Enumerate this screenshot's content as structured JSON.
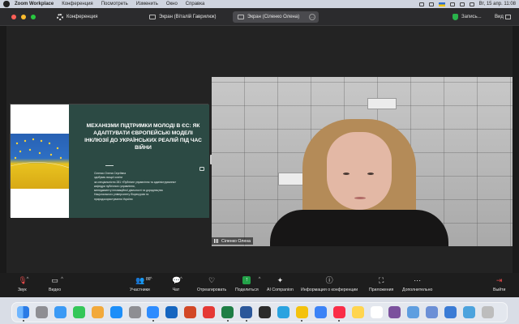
{
  "menubar": {
    "app": "Zoom Workplace",
    "items": [
      "Конференция",
      "Посмотреть",
      "Изменить",
      "Окно",
      "Справка"
    ],
    "clock": "Вт, 15 апр. 11:08"
  },
  "titlebar": {
    "conference_label": "Конференция",
    "tab1": "Экран (Віталій Гаврилюк)",
    "tab2": "Экран (Сіленко Олена)",
    "record_label": "Запись...",
    "view_label": "Вид"
  },
  "slide": {
    "title": "МЕХАНІЗМИ ПІДТРИМКИ МОЛОДІ В ЄС: ЯК АДАПТУВАТИ ЄВРОПЕЙСЬКІ МОДЕЛІ ІНКЛЮЗІЇ ДО УКРАЇНСЬКИХ РЕАЛІЙ ПІД ЧАС ВІЙНИ",
    "body": [
      "Сіленко Олена Сергіївна",
      "здобувач вищої освіти",
      "за спеціальністю 281 «Публічне управління та адміністрування»",
      "кафедри публічного управління,",
      "менеджменту інноваційної діяльності та дорадництва",
      "Національного університету біоресурсів та",
      "природокористування України"
    ]
  },
  "video": {
    "participant_name": "Сіленко Олена"
  },
  "toolbar": {
    "mute_label": "Звук",
    "video_label": "Видео",
    "participants_label": "Участники",
    "participants_count": "86",
    "chat_label": "Чат",
    "react_label": "Отреагировать",
    "share_label": "Поделиться",
    "ai_label": "AI Companion",
    "info_label": "Информация о конференции",
    "apps_label": "Приложения",
    "more_label": "Дополнительно",
    "leave_label": "Выйти"
  },
  "dock": {
    "icons": [
      "finder-icon",
      "launchpad-icon",
      "safari-icon",
      "facetime-icon",
      "photos-icon",
      "appstore-icon",
      "settings-icon",
      "zoom-icon",
      "outlook-icon",
      "powerpoint-icon",
      "pdf-icon",
      "excel-icon",
      "word-icon",
      "terminal-icon",
      "telegram-icon",
      "chrome-icon",
      "mail-icon",
      "music-icon",
      "notes-icon",
      "calendar-icon",
      "viber-icon",
      "preview-icon",
      "files-icon",
      "downloads-icon",
      "folder-icon",
      "trash-icon"
    ]
  }
}
